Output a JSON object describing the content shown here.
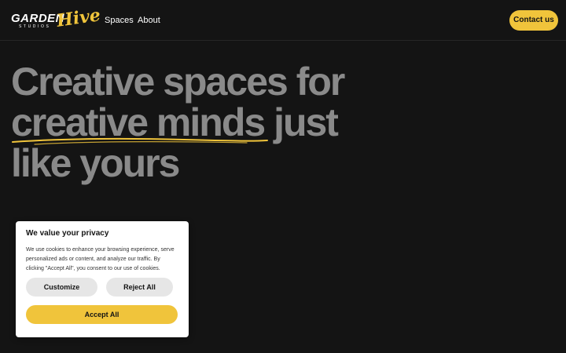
{
  "header": {
    "logo": {
      "main": "GARDEN",
      "sub": "STUDIOS",
      "script": "Hive"
    },
    "nav": [
      {
        "label": "Spaces"
      },
      {
        "label": "About"
      }
    ],
    "contact_label": "Contact us"
  },
  "hero": {
    "line1": "Creative spaces for",
    "line2_highlight": "creative minds",
    "line2_rest": " just",
    "line3": "like yours"
  },
  "cookie": {
    "title": "We value your privacy",
    "body": "We use cookies to enhance your browsing experience, serve personalized ads or content, and analyze our traffic. By clicking \"Accept All\", you consent to our use of cookies.",
    "customize_label": "Customize",
    "reject_label": "Reject All",
    "accept_label": "Accept All"
  },
  "colors": {
    "accent": "#f0c43b",
    "background": "#141414",
    "hero_text": "#8a8a8a"
  }
}
